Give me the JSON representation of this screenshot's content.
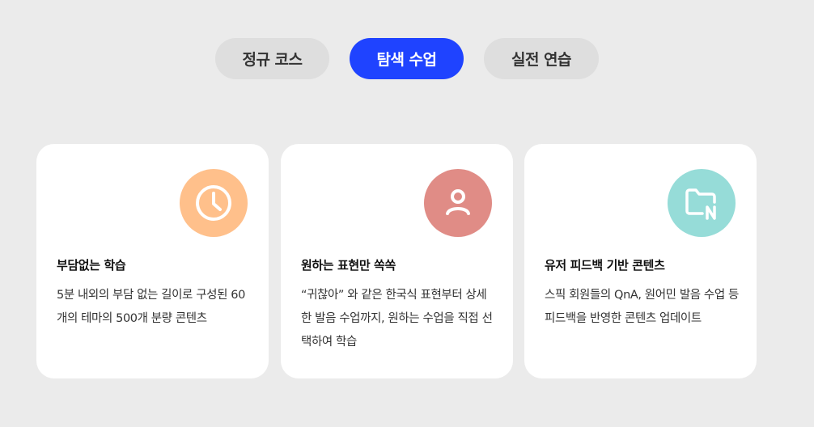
{
  "tabs": [
    {
      "label": "정규 코스",
      "active": false
    },
    {
      "label": "탐색 수업",
      "active": true
    },
    {
      "label": "실전 연습",
      "active": false
    }
  ],
  "cards": [
    {
      "icon": "clock-icon",
      "icon_bg": "#ffc08b",
      "title": "부담없는 학습",
      "description": "5분 내외의 부담 없는 길이로 구성된 60개의 테마의 500개 분량 콘텐츠"
    },
    {
      "icon": "user-icon",
      "icon_bg": "#e08c86",
      "title": "원하는 표현만 쏙쏙",
      "description": "“귀찮아” 와 같은 한국식 표현부터 상세한 발음 수업까지, 원하는 수업을 직접 선택하여 학습"
    },
    {
      "icon": "folder-new-icon",
      "icon_bg": "#96dcd8",
      "title": "유저 피드백 기반 콘텐츠",
      "description": "스픽 회원들의 QnA, 원어민 발음 수업 등 피드백을 반영한 콘텐츠 업데이트"
    }
  ],
  "colors": {
    "background": "#ebebeb",
    "tab_inactive": "#dedede",
    "tab_active": "#1f43ff",
    "card": "#ffffff"
  }
}
